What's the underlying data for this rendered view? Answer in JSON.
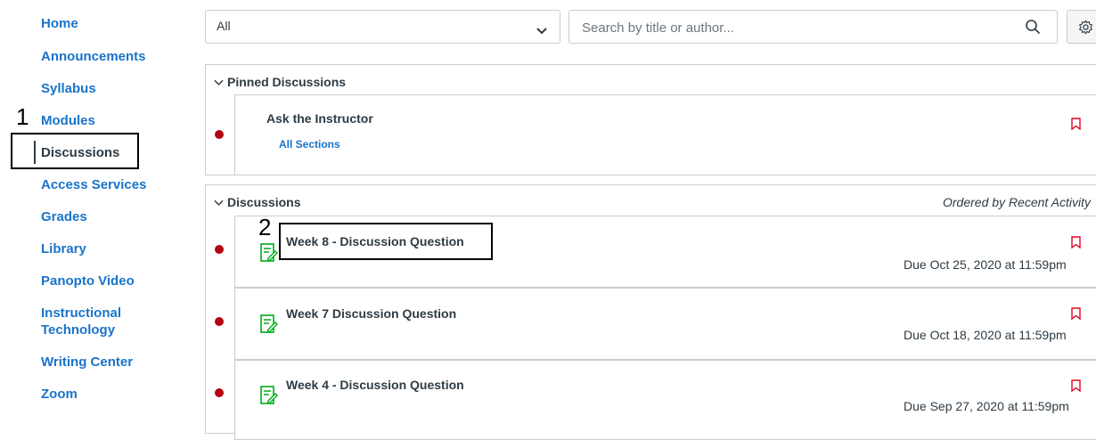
{
  "nav": {
    "items": [
      {
        "label": "Home"
      },
      {
        "label": "Announcements"
      },
      {
        "label": "Syllabus"
      },
      {
        "label": "Modules"
      },
      {
        "label": "Discussions",
        "active": true
      },
      {
        "label": "Access Services"
      },
      {
        "label": "Grades"
      },
      {
        "label": "Library"
      },
      {
        "label": "Panopto Video"
      },
      {
        "label": "Instructional Technology"
      },
      {
        "label": "Writing Center"
      },
      {
        "label": "Zoom"
      }
    ]
  },
  "annotations": {
    "step1": "1",
    "step2": "2"
  },
  "filter": {
    "selected": "All"
  },
  "search": {
    "placeholder": "Search by title or author..."
  },
  "pinned": {
    "header": "Pinned Discussions",
    "items": [
      {
        "title": "Ask the Instructor",
        "section": "All Sections"
      }
    ]
  },
  "discussions": {
    "header": "Discussions",
    "order_label": "Ordered by Recent Activity",
    "items": [
      {
        "title": "Week 8 - Discussion Question",
        "due": "Due Oct 25, 2020 at 11:59pm"
      },
      {
        "title": "Week 7 Discussion Question",
        "due": "Due Oct 18, 2020 at 11:59pm"
      },
      {
        "title": "Week 4 - Discussion Question",
        "due": "Due Sep 27, 2020 at 11:59pm"
      }
    ]
  },
  "colors": {
    "link": "#1a73c9",
    "text": "#2d3b45",
    "unread": "#b5000f",
    "assignment": "#00ac18",
    "bookmark": "#e0061f"
  },
  "icons": [
    "chevron-down-icon",
    "search-icon",
    "gear-icon",
    "unread-dot-icon",
    "bookmark-icon",
    "assignment-icon"
  ]
}
